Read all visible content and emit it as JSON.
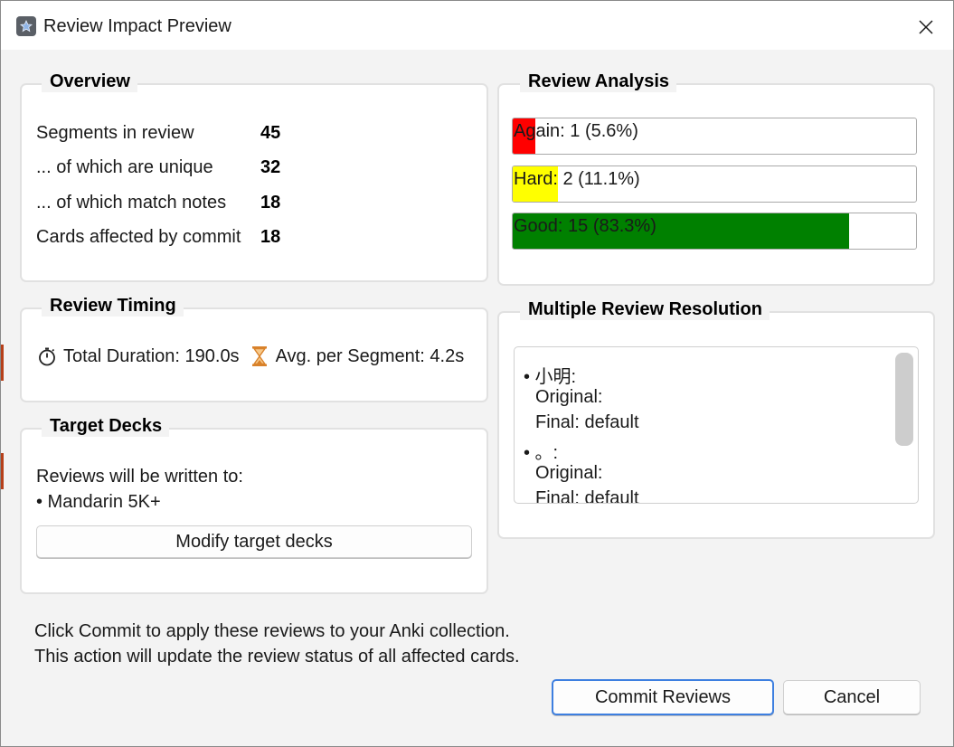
{
  "window": {
    "title": "Review Impact Preview"
  },
  "overview": {
    "title": "Overview",
    "stats": [
      {
        "label": "Segments in review",
        "value": "45"
      },
      {
        "label": "... of which are unique",
        "value": "32"
      },
      {
        "label": "... of which match notes",
        "value": "18"
      },
      {
        "label": "Cards affected by commit",
        "value": "18"
      }
    ]
  },
  "review_analysis": {
    "title": "Review Analysis",
    "bars": [
      {
        "label": "Again: 1 (5.6%)",
        "fraction": 0.056,
        "color": "#ff0000"
      },
      {
        "label": "Hard: 2 (11.1%)",
        "fraction": 0.111,
        "color": "#ffff00"
      },
      {
        "label": "Good: 15 (83.3%)",
        "fraction": 0.833,
        "color": "#008000"
      }
    ]
  },
  "review_timing": {
    "title": "Review Timing",
    "total_duration": "Total Duration: 190.0s",
    "avg_per_segment": "Avg. per Segment: 4.2s"
  },
  "target_decks": {
    "title": "Target Decks",
    "intro": "Reviews will be written to:",
    "decks": [
      "• Mandarin 5K+"
    ],
    "modify_button": "Modify target decks"
  },
  "multiple_review": {
    "title": "Multiple Review Resolution",
    "entries": [
      {
        "head": "• 小明:",
        "original": "Original:",
        "final": "Final: default"
      },
      {
        "head": "• 。:",
        "original": "Original:",
        "final": "Final: default"
      }
    ]
  },
  "footer": {
    "line1": "Click Commit to apply these reviews to your Anki collection.",
    "line2": "This action will update the review status of all affected cards.",
    "commit_button": "Commit Reviews",
    "cancel_button": "Cancel"
  },
  "colors": {
    "accent": "#3d7fe0",
    "again": "#ff0000",
    "hard": "#ffff00",
    "good": "#008000"
  }
}
